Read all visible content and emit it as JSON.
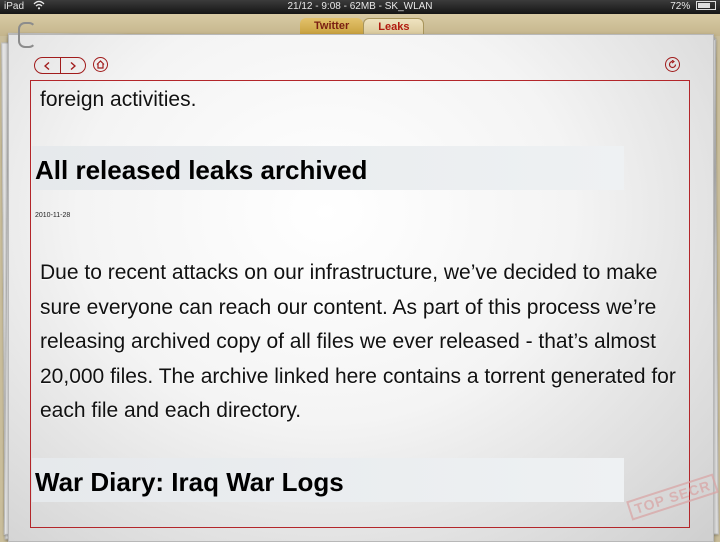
{
  "status_bar": {
    "device": "iPad",
    "center": "21/12 - 9:08 - 62MB - SK_WLAN",
    "battery_text": "72%",
    "battery_level": 0.72,
    "wifi_icon": "wifi-icon",
    "battery_icon": "battery-icon"
  },
  "tabs": [
    {
      "label": "Twitter",
      "active": false
    },
    {
      "label": "Leaks",
      "active": true
    }
  ],
  "nav": {
    "back_icon": "chevron-left-icon",
    "forward_icon": "chevron-right-icon",
    "home_icon": "home-icon",
    "reload_icon": "reload-icon"
  },
  "article": {
    "intro_line": "foreign activities.",
    "sections": [
      {
        "heading": "All released leaks archived",
        "date": "2010-11-28",
        "body": "Due to recent attacks on our infrastructure, we’ve decided to make sure everyone can reach our content. As part of this process we’re releasing archived copy of all files we ever released - that’s almost 20,000 files. The archive linked here contains a torrent generated for each file and each directory."
      },
      {
        "heading": "War Diary: Iraq War Logs"
      }
    ]
  },
  "stamp_text": "TOP SECR",
  "colors": {
    "accent_red": "#a11c1c",
    "frame_red": "#b3262a",
    "leaks_tab_text": "#b11a0f",
    "heading_band": "#e6e9ec"
  }
}
